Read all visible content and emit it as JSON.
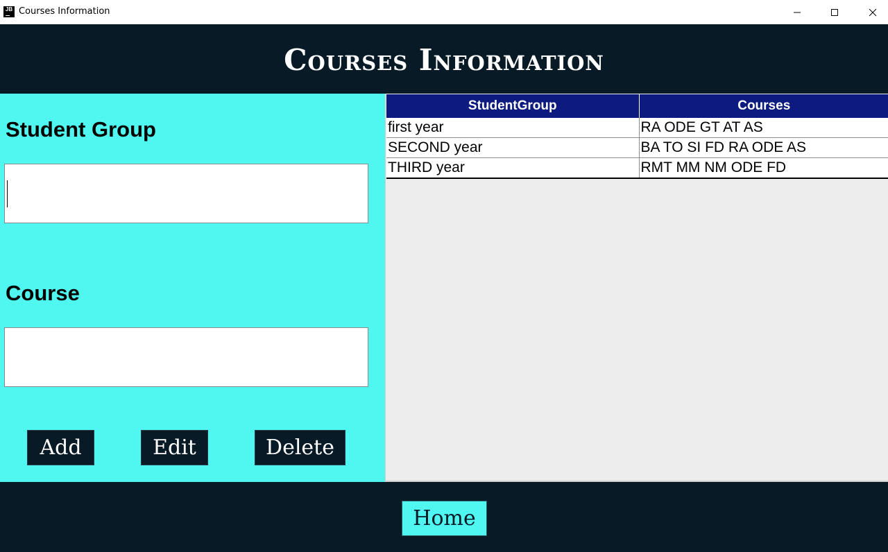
{
  "window": {
    "title": "Courses Information",
    "app_icon_text": "JB",
    "controls": {
      "minimize": "minimize-icon",
      "maximize": "maximize-icon",
      "close": "close-icon"
    }
  },
  "header": {
    "title": "Courses Information"
  },
  "form": {
    "student_group_label": "Student Group",
    "student_group_value": "",
    "course_label": "Course",
    "course_value": "",
    "buttons": {
      "add": "Add",
      "edit": "Edit",
      "delete": "Delete"
    }
  },
  "table": {
    "columns": [
      "StudentGroup",
      "Courses"
    ],
    "rows": [
      [
        "first year",
        "RA ODE GT AT AS"
      ],
      [
        "SECOND year",
        "BA TO SI FD RA ODE AS"
      ],
      [
        "THIRD year",
        "RMT MM NM ODE FD"
      ]
    ]
  },
  "footer": {
    "home": "Home"
  },
  "colors": {
    "dark": "#081A25",
    "cyan": "#50F6F0",
    "table_header": "#0D1B80",
    "table_bg": "#EDEDED"
  }
}
